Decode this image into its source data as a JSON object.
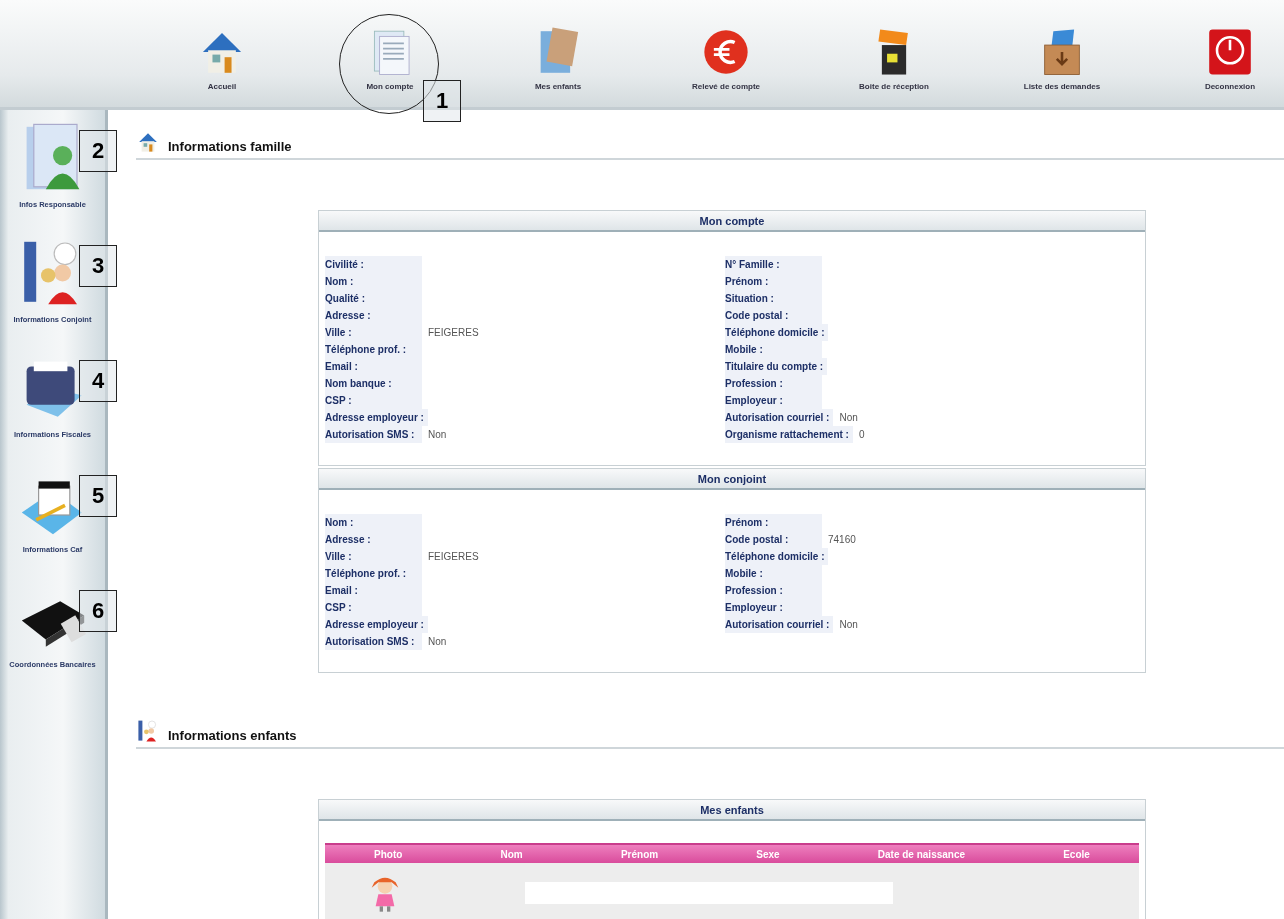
{
  "nav": [
    {
      "label": "Accueil",
      "circled": false
    },
    {
      "label": "Mon compte",
      "circled": true,
      "callout": "1"
    },
    {
      "label": "Mes enfants",
      "circled": false
    },
    {
      "label": "Relevé de compte",
      "circled": false
    },
    {
      "label": "Boite de réception",
      "circled": false
    },
    {
      "label": "Liste des demandes",
      "circled": false
    },
    {
      "label": "Deconnexion",
      "circled": false
    }
  ],
  "sidebar": [
    {
      "label": "Infos Responsable",
      "callout": "2"
    },
    {
      "label": "Informations Conjoint",
      "callout": "3"
    },
    {
      "label": "Informations Fiscales",
      "callout": "4"
    },
    {
      "label": "Informations Caf",
      "callout": "5"
    },
    {
      "label": "Coordonnées Bancaires",
      "callout": "6"
    }
  ],
  "sections": [
    {
      "title": "Informations famille",
      "cards": [
        {
          "kind": "fields",
          "title": "Mon compte",
          "left": [
            {
              "label": "Civilité :"
            },
            {
              "label": "Nom :"
            },
            {
              "label": "Qualité :"
            },
            {
              "label": "Adresse :"
            },
            {
              "label": "Ville :",
              "value": "FEIGERES"
            },
            {
              "label": "Téléphone prof. :"
            },
            {
              "label": "Email :"
            },
            {
              "label": "Nom banque :"
            },
            {
              "label": "CSP :"
            },
            {
              "label": "Adresse employeur :"
            },
            {
              "label": "Autorisation SMS :",
              "value": "Non"
            }
          ],
          "right": [
            {
              "label": "N° Famille :"
            },
            {
              "label": "Prénom :"
            },
            {
              "label": "Situation :"
            },
            {
              "label": "Code postal :"
            },
            {
              "label": "Téléphone domicile :"
            },
            {
              "label": "Mobile :"
            },
            {
              "label": "Titulaire du compte :"
            },
            {
              "label": "Profession :"
            },
            {
              "label": "Employeur :"
            },
            {
              "label": "Autorisation courriel :",
              "value": "Non"
            },
            {
              "label": "Organisme rattachement :",
              "value": "0"
            }
          ]
        },
        {
          "kind": "fields",
          "title": "Mon conjoint",
          "left": [
            {
              "label": "Nom :"
            },
            {
              "label": "Adresse :"
            },
            {
              "label": "Ville :",
              "value": "FEIGERES"
            },
            {
              "label": "Téléphone prof. :"
            },
            {
              "label": "Email :"
            },
            {
              "label": "CSP :"
            },
            {
              "label": "Adresse employeur :"
            },
            {
              "label": "Autorisation SMS :",
              "value": "Non"
            }
          ],
          "right": [
            {
              "label": "Prénom :"
            },
            {
              "label": "Code postal :",
              "value": "74160"
            },
            {
              "label": "Téléphone domicile :"
            },
            {
              "label": "Mobile :"
            },
            {
              "label": "Profession :"
            },
            {
              "label": "Employeur :"
            },
            {
              "label": "Autorisation courriel :",
              "value": "Non"
            }
          ]
        }
      ]
    },
    {
      "title": "Informations enfants",
      "cards": [
        {
          "kind": "table",
          "title": "Mes enfants",
          "columns": [
            "Photo",
            "Nom",
            "Prénom",
            "Sexe",
            "Date de naissance",
            "Ecole"
          ]
        }
      ]
    }
  ]
}
